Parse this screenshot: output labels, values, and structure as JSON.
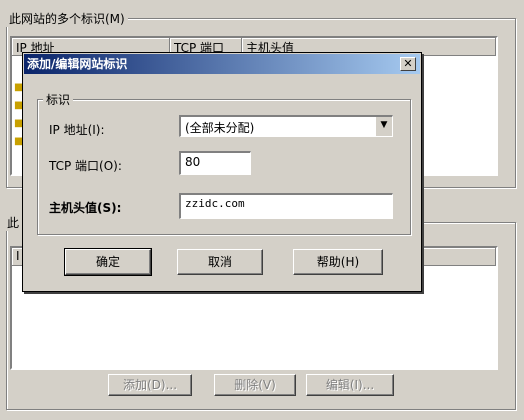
{
  "background": {
    "group1_title": "此网站的多个标识(M)",
    "group1_headers": [
      "IP 地址",
      "TCP 端口",
      "主机头值"
    ],
    "group2_title": "此",
    "group2_headers": [
      "I"
    ],
    "buttons": [
      "添加(D)...",
      "删除(V)",
      "编辑(I)..."
    ]
  },
  "dialog": {
    "title": "添加/编辑网站标识",
    "group_title": "标识",
    "ip_label": "IP 地址(I):",
    "ip_value": "(全部未分配)",
    "port_label": "TCP 端口(O):",
    "port_value": "80",
    "host_label": "主机头值(S):",
    "host_value": "zzidc.com",
    "ok_label": "确定",
    "cancel_label": "取消",
    "help_label": "帮助(H)",
    "close_glyph": "✕"
  }
}
